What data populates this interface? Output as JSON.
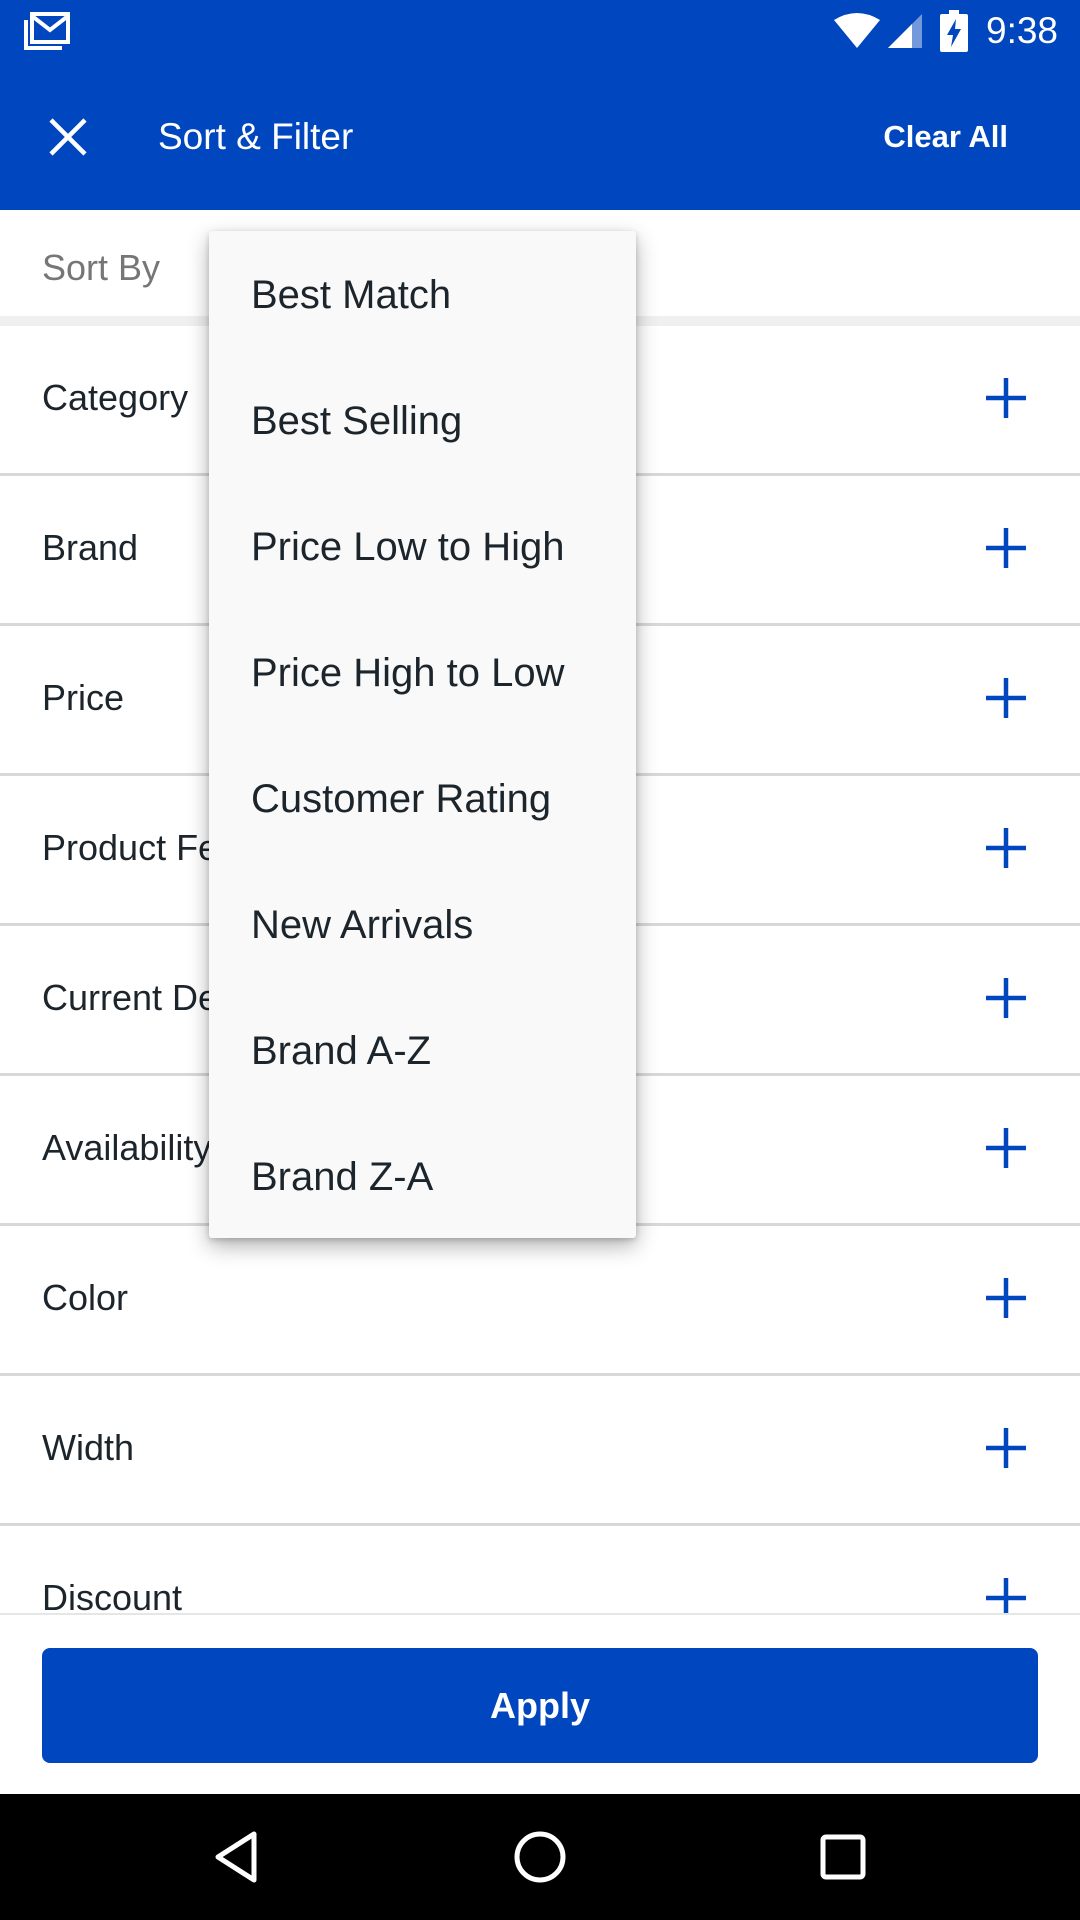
{
  "status_bar": {
    "time": "9:38",
    "icons": [
      "gmail-icon",
      "wifi-icon",
      "signal-icon",
      "battery-charging-icon"
    ]
  },
  "app_bar": {
    "close_icon": "close-icon",
    "title": "Sort & Filter",
    "clear_all_label": "Clear All",
    "background_color": "#0046be"
  },
  "sort": {
    "label": "Sort By",
    "options": [
      "Best Match",
      "Best Selling",
      "Price Low to High",
      "Price High to Low",
      "Customer Rating",
      "New Arrivals",
      "Brand A-Z",
      "Brand Z-A"
    ]
  },
  "filters": {
    "expand_icon": "plus-icon",
    "items": [
      {
        "label": "Category"
      },
      {
        "label": "Brand"
      },
      {
        "label": "Price"
      },
      {
        "label": "Product Features"
      },
      {
        "label": "Current Deals"
      },
      {
        "label": "Availability"
      },
      {
        "label": "Color"
      },
      {
        "label": "Width"
      },
      {
        "label": "Discount"
      }
    ]
  },
  "apply_label": "Apply",
  "nav_bar": {
    "icons": [
      "back-icon",
      "home-icon",
      "recents-icon"
    ]
  },
  "colors": {
    "accent": "#0046be",
    "text": "#1d252c",
    "muted": "#767676"
  }
}
